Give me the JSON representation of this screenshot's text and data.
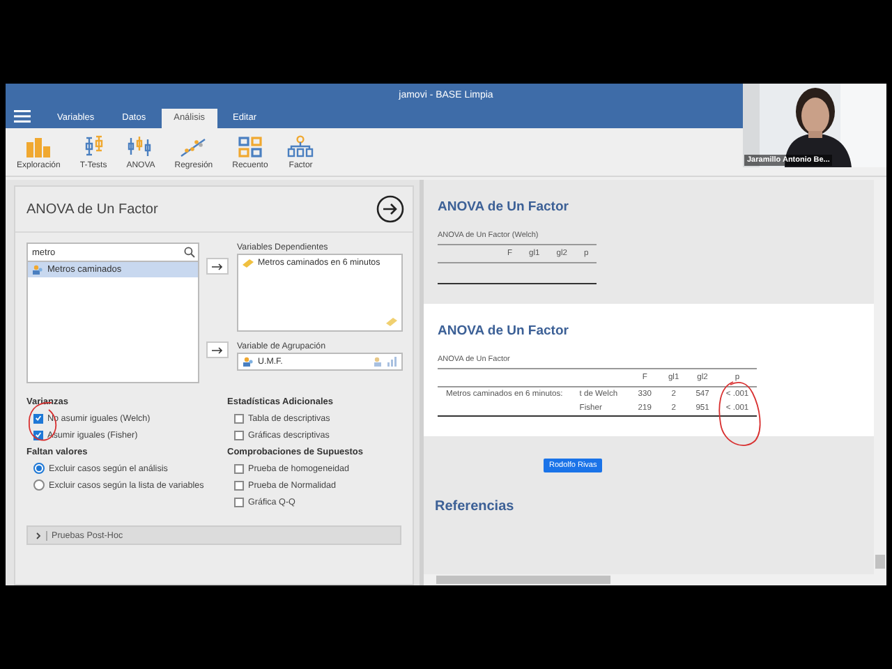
{
  "window": {
    "title": "jamovi - BASE Limpia"
  },
  "tabs": [
    {
      "label": "Variables",
      "selected": false
    },
    {
      "label": "Datos",
      "selected": false
    },
    {
      "label": "Análisis",
      "selected": true
    },
    {
      "label": "Editar",
      "selected": false
    }
  ],
  "ribbon": [
    {
      "label": "Exploración",
      "kind": "exploration"
    },
    {
      "label": "T-Tests",
      "kind": "ttests"
    },
    {
      "label": "ANOVA",
      "kind": "anova"
    },
    {
      "label": "Regresión",
      "kind": "regression"
    },
    {
      "label": "Recuento",
      "kind": "frequencies"
    },
    {
      "label": "Factor",
      "kind": "factor"
    }
  ],
  "analysis_panel": {
    "title": "ANOVA de Un Factor",
    "search": {
      "value": "metro"
    },
    "variables": [
      {
        "name": "Metros caminados",
        "selected": true
      }
    ],
    "dependent": {
      "label": "Variables Dependientes",
      "items": [
        "Metros caminados en 6 minutos"
      ]
    },
    "grouping": {
      "label": "Variable de Agrupación",
      "items": [
        "U.M.F."
      ]
    },
    "option_columns": [
      [
        {
          "title": "Varianzas",
          "options": [
            {
              "kind": "checkbox",
              "label": "No asumir iguales (Welch)",
              "checked": true
            },
            {
              "kind": "checkbox",
              "label": "Asumir iguales (Fisher)",
              "checked": true
            }
          ]
        },
        {
          "title": "Faltan valores",
          "options": [
            {
              "kind": "radio",
              "label": "Excluir casos según el análisis",
              "selected": true
            },
            {
              "kind": "radio",
              "label": "Excluir casos según la lista de variables",
              "selected": false
            }
          ]
        }
      ],
      [
        {
          "title": "Estadísticas Adicionales",
          "options": [
            {
              "kind": "checkbox",
              "label": "Tabla de descriptivas",
              "checked": false
            },
            {
              "kind": "checkbox",
              "label": "Gráficas descriptivas",
              "checked": false
            }
          ]
        },
        {
          "title": "Comprobaciones de Supuestos",
          "options": [
            {
              "kind": "checkbox",
              "label": "Prueba de homogeneidad",
              "checked": false
            },
            {
              "kind": "checkbox",
              "label": "Prueba de Normalidad",
              "checked": false
            },
            {
              "kind": "checkbox",
              "label": "Gráfica Q-Q",
              "checked": false
            }
          ]
        }
      ]
    ],
    "collapsed_section": {
      "label": "Pruebas Post-Hoc",
      "expanded": false
    }
  },
  "results": [
    {
      "title": "ANOVA de Un Factor",
      "selected": false,
      "table": {
        "title": "ANOVA de Un Factor (Welch)",
        "columns": [
          "F",
          "gl1",
          "gl2",
          "p"
        ]
      }
    },
    {
      "title": "ANOVA de Un Factor",
      "selected": true,
      "table": {
        "title": "ANOVA de Un Factor",
        "columns": [
          "F",
          "gl1",
          "gl2",
          "p"
        ],
        "rows": [
          {
            "variable": "Metros caminados en 6 minutos:",
            "test": "t de Welch",
            "values": [
              "330",
              "2",
              "547",
              "< .001"
            ]
          },
          {
            "test": "Fisher",
            "values": [
              "219",
              "2",
              "951",
              "< .001"
            ]
          }
        ]
      }
    }
  ],
  "name_tag": "Rodolfo Rivas",
  "references_title": "Referencias",
  "webcam": {
    "name": "Jaramillo Antonio Be..."
  }
}
